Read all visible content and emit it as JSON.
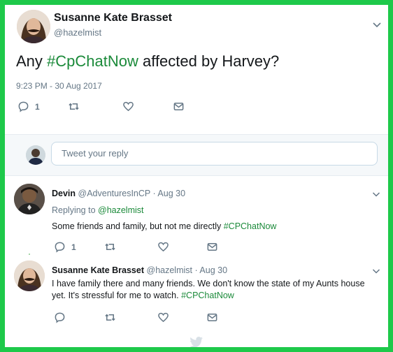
{
  "main_tweet": {
    "name": "Susanne Kate Brasset",
    "handle": "@hazelmist",
    "text_prefix": "Any ",
    "hashtag": "#CpChatNow",
    "text_suffix": " affected by Harvey?",
    "timestamp": "9:23 PM - 30 Aug 2017",
    "reply_count": "1"
  },
  "reply_box": {
    "placeholder": "Tweet your reply"
  },
  "replies": [
    {
      "name": "Devin",
      "meta": "@AdventuresInCP · Aug 30",
      "replying_label": "Replying to ",
      "replying_handle": "@hazelmist",
      "text": "Some friends and family, but not me directly ",
      "hashtag": "#CPChatNow",
      "reply_count": "1"
    },
    {
      "name": "Susanne Kate Brasset",
      "meta": "@hazelmist · Aug 30",
      "text": "I have family there and many friends.  We don't know the state of my Aunts house yet. It's stressful for me to watch. ",
      "hashtag": "#CPChatNow"
    }
  ],
  "colors": {
    "border": "#1ec94a",
    "hashtag": "#1b8a3a",
    "muted": "#657786"
  }
}
